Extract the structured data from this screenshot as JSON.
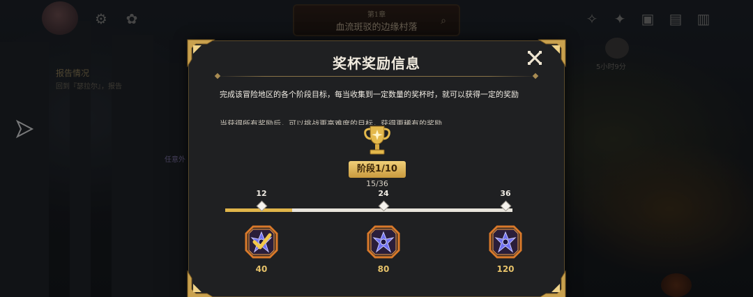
{
  "hud": {
    "chapter": "第1章",
    "location": "血流斑驳的边缘村落",
    "report_title": "报告情况",
    "report_sub": "回到『瑟拉尔』，报告",
    "left_tag": "任意外",
    "timer": "5小时9分"
  },
  "modal": {
    "title": "奖杯奖励信息",
    "description": "完成该冒险地区的各个阶段目标，每当收集到一定数量的奖杯时，就可以获得一定的奖励",
    "description_cut": "当获得所有奖励后，可以挑战更高难度的目标，获得更稀有的奖励",
    "stage_label": "阶段1/10",
    "progress": "15/36",
    "progress_value": 15,
    "progress_max": 36,
    "milestones": [
      {
        "threshold": "12",
        "reward": "40",
        "claimed": true
      },
      {
        "threshold": "24",
        "reward": "80",
        "claimed": false
      },
      {
        "threshold": "36",
        "reward": "120",
        "claimed": false
      }
    ]
  },
  "colors": {
    "gold": "#e0b54a",
    "panel": "#1f2022",
    "reward_frame": "#d9792a",
    "gem": "#6f6ff0"
  },
  "icons": [
    "close-icon",
    "trophy-icon",
    "shuriken-gem-icon",
    "check-icon",
    "share-icon",
    "zoom-icon"
  ]
}
